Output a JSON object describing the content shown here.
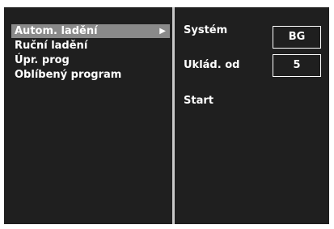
{
  "menu": {
    "items": [
      {
        "label": "Autom. ladění",
        "selected": true
      },
      {
        "label": "Ruční ladění",
        "selected": false
      },
      {
        "label": "Úpr. prog",
        "selected": false
      },
      {
        "label": "Oblíbený program",
        "selected": false
      }
    ],
    "arrow_icon": "play-triangle-icon"
  },
  "settings": {
    "system_label": "Systém",
    "system_value": "BG",
    "save_label": "Uklád. od",
    "save_value": "5",
    "start_label": "Start"
  },
  "colors": {
    "background": "#1f1f1f",
    "highlight": "#8a8a8a",
    "divider": "#c8c8c8",
    "text": "#ffffff"
  }
}
